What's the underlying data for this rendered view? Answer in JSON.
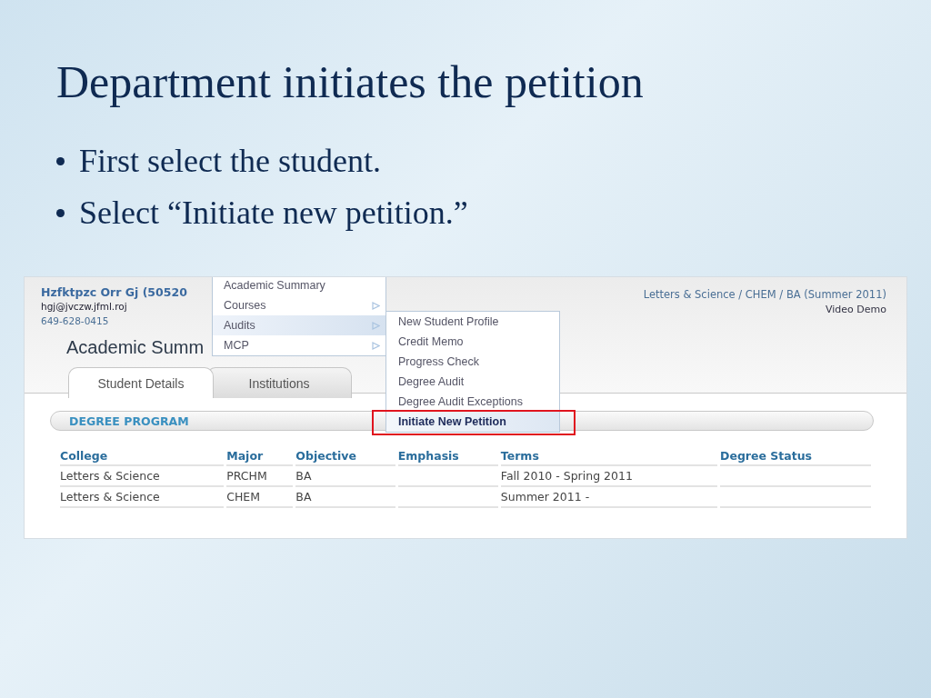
{
  "slide": {
    "title": "Department initiates the petition",
    "bullets": [
      "First select the student.",
      "Select “Initiate new petition.”"
    ]
  },
  "screenshot": {
    "student": {
      "name": "Hzfktpzc Orr Gj (50520",
      "email": "hgj@jvczw.jfml.roj",
      "phone": "649-628-0415"
    },
    "program_info": "Letters & Science / CHEM / BA (Summer 2011)",
    "video_link": "Video Demo",
    "heading": "Academic Summ",
    "tabs": [
      {
        "label": "Student Details",
        "selected": true
      },
      {
        "label": "Institutions",
        "selected": false
      }
    ],
    "menu": [
      {
        "label": "Academic Summary",
        "has_submenu": false,
        "selected": false
      },
      {
        "label": "Courses",
        "has_submenu": true,
        "selected": false
      },
      {
        "label": "Audits",
        "has_submenu": true,
        "selected": true
      },
      {
        "label": "MCP",
        "has_submenu": true,
        "selected": false
      }
    ],
    "submenu": [
      {
        "label": "New Student Profile",
        "selected": false
      },
      {
        "label": "Credit Memo",
        "selected": false
      },
      {
        "label": "Progress Check",
        "selected": false
      },
      {
        "label": "Degree Audit",
        "selected": false
      },
      {
        "label": "Degree Audit Exceptions",
        "selected": false
      },
      {
        "label": "Initiate New Petition",
        "selected": true
      }
    ],
    "section_title": "DEGREE PROGRAM",
    "table": {
      "columns": [
        "College",
        "Major",
        "Objective",
        "Emphasis",
        "Terms",
        "Degree Status"
      ],
      "rows": [
        [
          "Letters & Science",
          "PRCHM",
          "BA",
          "",
          "Fall 2010 - Spring 2011",
          ""
        ],
        [
          "Letters & Science",
          "CHEM",
          "BA",
          "",
          "Summer 2011 -",
          ""
        ]
      ]
    }
  }
}
